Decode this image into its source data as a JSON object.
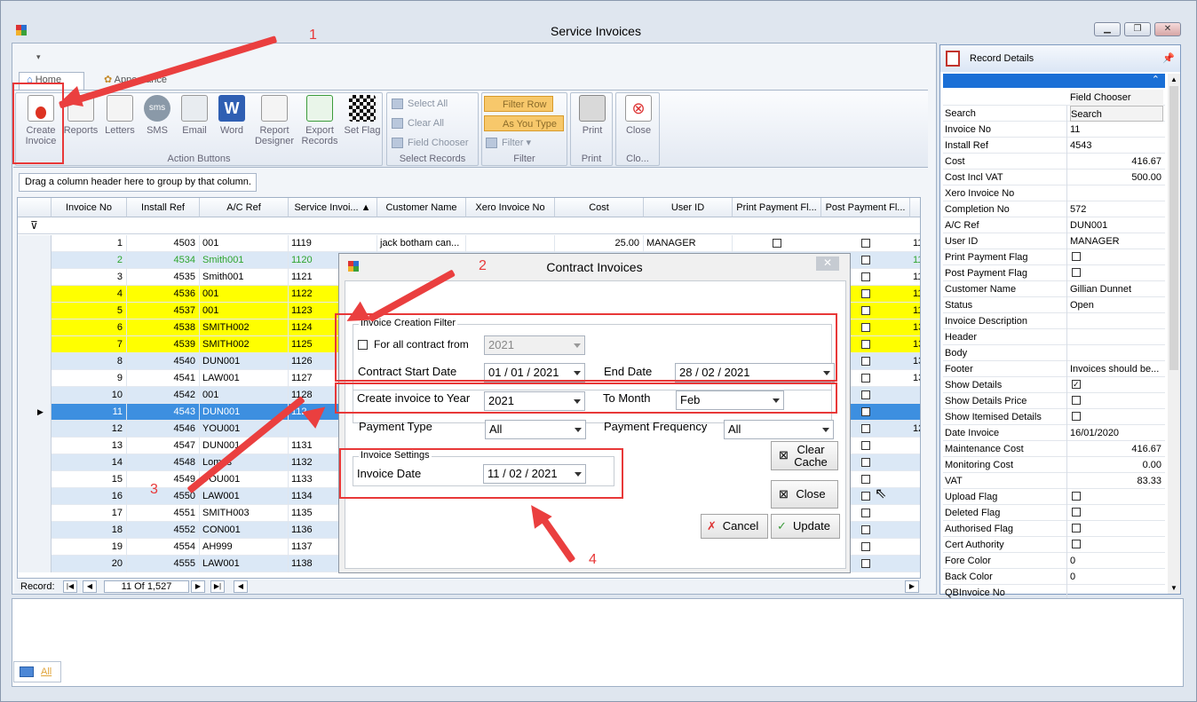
{
  "window": {
    "title": "Service Invoices"
  },
  "ribbon": {
    "tabs": [
      "Home",
      "Appearance"
    ],
    "buttons": [
      {
        "label": "Create Invoice",
        "icon": "create-invoice-icon"
      },
      {
        "label": "Reports",
        "icon": "reports-icon"
      },
      {
        "label": "Letters",
        "icon": "letters-icon"
      },
      {
        "label": "SMS",
        "icon": "sms-icon"
      },
      {
        "label": "Email",
        "icon": "email-icon"
      },
      {
        "label": "Word",
        "icon": "word-icon"
      },
      {
        "label": "Report Designer",
        "icon": "report-designer-icon"
      },
      {
        "label": "Export Records",
        "icon": "export-records-icon"
      },
      {
        "label": "Set Flag",
        "icon": "set-flag-icon"
      }
    ],
    "action_group": "Action Buttons",
    "select": {
      "select_all": "Select All",
      "clear_all": "Clear All",
      "field_chooser": "Field Chooser",
      "label": "Select Records"
    },
    "filter": {
      "filter_row": "Filter Row",
      "as_you_type": "As You Type",
      "filter": "Filter",
      "label": "Filter"
    },
    "print": {
      "label": "Print",
      "group": "Print"
    },
    "close": {
      "label": "Close",
      "group": "Clo..."
    }
  },
  "grid": {
    "group_hint": "Drag a column header here to group by that column.",
    "columns": [
      "Invoice No",
      "Install Ref",
      "A/C Ref",
      "Service Invoi...",
      "Customer Name",
      "Xero Invoice No",
      "Cost",
      "User ID",
      "Print Payment Fl...",
      "Post Payment Fl..."
    ],
    "rows": [
      {
        "inv": "1",
        "install": "4503",
        "ac": "001",
        "svc": "1119",
        "cust": "jack botham can...",
        "cost": "25.00",
        "user": "MANAGER",
        "style": "white",
        "tail": "11"
      },
      {
        "inv": "2",
        "install": "4534",
        "ac": "Smith001",
        "svc": "1120",
        "cust": "",
        "cost": "",
        "user": "",
        "style": "alt green",
        "tail": "11"
      },
      {
        "inv": "3",
        "install": "4535",
        "ac": "Smith001",
        "svc": "1121",
        "cust": "",
        "cost": "",
        "user": "",
        "style": "white",
        "tail": "11"
      },
      {
        "inv": "4",
        "install": "4536",
        "ac": "001",
        "svc": "1122",
        "cust": "",
        "cost": "",
        "user": "",
        "style": "yellow",
        "tail": "11"
      },
      {
        "inv": "5",
        "install": "4537",
        "ac": "001",
        "svc": "1123",
        "cust": "",
        "cost": "",
        "user": "",
        "style": "yellow",
        "tail": "11"
      },
      {
        "inv": "6",
        "install": "4538",
        "ac": "SMITH002",
        "svc": "1124",
        "cust": "",
        "cost": "",
        "user": "",
        "style": "yellow",
        "tail": "13"
      },
      {
        "inv": "7",
        "install": "4539",
        "ac": "SMITH002",
        "svc": "1125",
        "cust": "",
        "cost": "",
        "user": "",
        "style": "yellow",
        "tail": "13"
      },
      {
        "inv": "8",
        "install": "4540",
        "ac": "DUN001",
        "svc": "1126",
        "cust": "",
        "cost": "",
        "user": "",
        "style": "alt",
        "tail": "13"
      },
      {
        "inv": "9",
        "install": "4541",
        "ac": "LAW001",
        "svc": "1127",
        "cust": "",
        "cost": "",
        "user": "",
        "style": "white",
        "tail": "13"
      },
      {
        "inv": "10",
        "install": "4542",
        "ac": "001",
        "svc": "1128",
        "cust": "",
        "cost": "",
        "user": "",
        "style": "alt",
        "tail": ""
      },
      {
        "inv": "11",
        "install": "4543",
        "ac": "DUN001",
        "svc": "112",
        "cust": "",
        "cost": "",
        "user": "",
        "style": "sel",
        "tail": ""
      },
      {
        "inv": "12",
        "install": "4546",
        "ac": "YOU001",
        "svc": "",
        "cust": "",
        "cost": "",
        "user": "",
        "style": "alt",
        "tail": "12"
      },
      {
        "inv": "13",
        "install": "4547",
        "ac": "DUN001",
        "svc": "1131",
        "cust": "",
        "cost": "",
        "user": "",
        "style": "white",
        "tail": ""
      },
      {
        "inv": "14",
        "install": "4548",
        "ac": "Lomas",
        "svc": "1132",
        "cust": "",
        "cost": "",
        "user": "",
        "style": "alt",
        "tail": ""
      },
      {
        "inv": "15",
        "install": "4549",
        "ac": "YOU001",
        "svc": "1133",
        "cust": "",
        "cost": "",
        "user": "",
        "style": "white",
        "tail": ""
      },
      {
        "inv": "16",
        "install": "4550",
        "ac": "LAW001",
        "svc": "1134",
        "cust": "",
        "cost": "",
        "user": "",
        "style": "alt",
        "tail": ""
      },
      {
        "inv": "17",
        "install": "4551",
        "ac": "SMITH003",
        "svc": "1135",
        "cust": "",
        "cost": "",
        "user": "",
        "style": "white",
        "tail": ""
      },
      {
        "inv": "18",
        "install": "4552",
        "ac": "CON001",
        "svc": "1136",
        "cust": "",
        "cost": "",
        "user": "",
        "style": "alt",
        "tail": ""
      },
      {
        "inv": "19",
        "install": "4554",
        "ac": "AH999",
        "svc": "1137",
        "cust": "",
        "cost": "",
        "user": "",
        "style": "white",
        "tail": ""
      },
      {
        "inv": "20",
        "install": "4555",
        "ac": "LAW001",
        "svc": "1138",
        "cust": "",
        "cost": "",
        "user": "",
        "style": "alt",
        "tail": ""
      }
    ],
    "record_label": "Record:",
    "record_pos": "11",
    "record_of": "Of",
    "record_total": "1,527"
  },
  "record_details": {
    "title": "Record Details",
    "field_chooser": "Field Chooser",
    "search_label": "Search",
    "search_value": "Search",
    "rows": [
      {
        "k": "Invoice No",
        "v": "11",
        "t": "text"
      },
      {
        "k": "Install Ref",
        "v": "4543",
        "t": "text"
      },
      {
        "k": "Cost",
        "v": "416.67",
        "t": "num"
      },
      {
        "k": "Cost Incl VAT",
        "v": "500.00",
        "t": "num"
      },
      {
        "k": "Xero Invoice No",
        "v": "",
        "t": "text"
      },
      {
        "k": "Completion No",
        "v": "572",
        "t": "text"
      },
      {
        "k": "A/C Ref",
        "v": "DUN001",
        "t": "text"
      },
      {
        "k": "User ID",
        "v": "MANAGER",
        "t": "text"
      },
      {
        "k": "Print Payment Flag",
        "v": "",
        "t": "check"
      },
      {
        "k": "Post Payment Flag",
        "v": "",
        "t": "check"
      },
      {
        "k": "Customer Name",
        "v": "Gillian Dunnet",
        "t": "text"
      },
      {
        "k": "Status",
        "v": "Open",
        "t": "text"
      },
      {
        "k": "Invoice Description",
        "v": "",
        "t": "text"
      },
      {
        "k": "Header",
        "v": "",
        "t": "text"
      },
      {
        "k": "Body",
        "v": "",
        "t": "text"
      },
      {
        "k": "Footer",
        "v": "Invoices should be...",
        "t": "text"
      },
      {
        "k": "Show Details",
        "v": "checked",
        "t": "check"
      },
      {
        "k": "Show Details Price",
        "v": "",
        "t": "check"
      },
      {
        "k": "Show Itemised Details",
        "v": "",
        "t": "check"
      },
      {
        "k": "Date Invoice",
        "v": "16/01/2020",
        "t": "text"
      },
      {
        "k": "Maintenance Cost",
        "v": "416.67",
        "t": "num"
      },
      {
        "k": "Monitoring Cost",
        "v": "0.00",
        "t": "num"
      },
      {
        "k": "VAT",
        "v": "83.33",
        "t": "num"
      },
      {
        "k": "Upload Flag",
        "v": "",
        "t": "check"
      },
      {
        "k": "Deleted Flag",
        "v": "",
        "t": "check"
      },
      {
        "k": "Authorised Flag",
        "v": "",
        "t": "check"
      },
      {
        "k": "Cert Authority",
        "v": "",
        "t": "check"
      },
      {
        "k": "Fore Color",
        "v": "0",
        "t": "text"
      },
      {
        "k": "Back Color",
        "v": "0",
        "t": "text"
      },
      {
        "k": "QBInvoice No",
        "v": "",
        "t": "text"
      }
    ]
  },
  "dialog": {
    "title": "Contract Invoices",
    "filter_legend": "Invoice Creation Filter",
    "for_all_label": "For all contract from",
    "for_all_year": "2021",
    "start_label": "Contract Start Date",
    "start_value": "01 / 01 / 2021",
    "end_label": "End Date",
    "end_value": "28 / 02 / 2021",
    "create_year_label": "Create invoice to Year",
    "create_year_value": "2021",
    "month_label": "To Month",
    "month_value": "Feb",
    "payment_type_label": "Payment Type",
    "payment_type_value": "All",
    "payment_freq_label": "Payment Frequency",
    "payment_freq_value": "All",
    "settings_legend": "Invoice Settings",
    "invoice_date_label": "Invoice Date",
    "invoice_date_value": "11 / 02 / 2021",
    "clear_cache": "Clear Cache",
    "close": "Close",
    "cancel": "Cancel",
    "update": "Update"
  },
  "annotations": [
    "1",
    "2",
    "3",
    "4"
  ],
  "bottom": {
    "tab": "All"
  },
  "colors": {
    "selected": "#3d8fe0",
    "highlight": "#ffff00",
    "annotation": "#e83838",
    "sidebar_accent": "#1a6fd6"
  }
}
